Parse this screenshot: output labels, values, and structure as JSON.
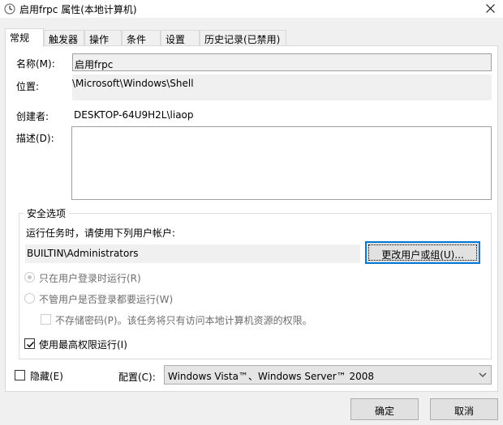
{
  "window": {
    "title": "启用frpc 属性(本地计算机)",
    "icon": "clock-task-icon"
  },
  "tabs": [
    {
      "label": "常规",
      "active": true
    },
    {
      "label": "触发器"
    },
    {
      "label": "操作"
    },
    {
      "label": "条件"
    },
    {
      "label": "设置"
    },
    {
      "label": "历史记录(已禁用)"
    }
  ],
  "general": {
    "name_label": "名称(M):",
    "name_value": "启用frpc",
    "location_label": "位置:",
    "location_value": "\\Microsoft\\Windows\\Shell",
    "author_label": "创建者:",
    "author_value": "DESKTOP-64U9H2L\\liaop",
    "description_label": "描述(D):",
    "description_value": ""
  },
  "security": {
    "group_label": "安全选项",
    "run_as_label": "运行任务时，请使用下列用户帐户:",
    "run_as_value": "BUILTIN\\Administrators",
    "change_user_button": "更改用户或组(U)...",
    "radio_logged_on": "只在用户登录时运行(R)",
    "radio_whether_logged": "不管用户是否登录都要运行(W)",
    "do_not_store_password": "不存储密码(P)。该任务将只有访问本地计算机资源的权限。",
    "highest_privileges": "使用最高权限运行(I)",
    "highest_privileges_checked": true
  },
  "bottom": {
    "hidden_label": "隐藏(E)",
    "hidden_checked": false,
    "configure_label": "配置(C):",
    "configure_value": "Windows Vista™、Windows Server™ 2008"
  },
  "buttons": {
    "ok": "确定",
    "cancel": "取消"
  },
  "colors": {
    "focus_border": "#0078d7",
    "field_background": "#f0f0f0"
  }
}
